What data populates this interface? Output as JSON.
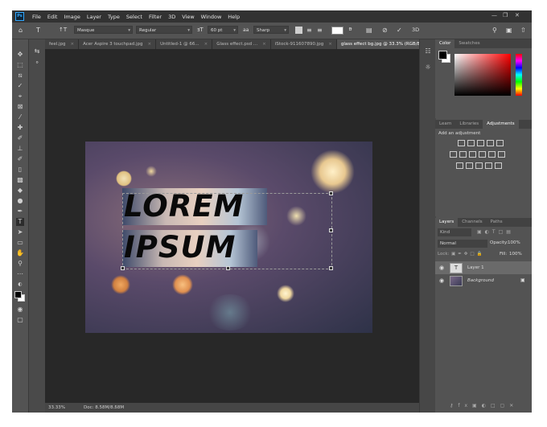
{
  "app": {
    "logo": "Ps"
  },
  "menu": [
    "File",
    "Edit",
    "Image",
    "Layer",
    "Type",
    "Select",
    "Filter",
    "3D",
    "View",
    "Window",
    "Help"
  ],
  "options": {
    "font_family": "Masque",
    "font_style": "Regular",
    "font_size": "60 pt",
    "antialias": "Sharp",
    "label_3d": "3D"
  },
  "tabs": [
    {
      "label": "feel.jpg",
      "active": false
    },
    {
      "label": "Acer Aspire 3 touchpad.jpg",
      "active": false
    },
    {
      "label": "Untitled-1 @ 66...",
      "active": false
    },
    {
      "label": "Glass effect.psd ...",
      "active": false
    },
    {
      "label": "iStock-911607890.jpg",
      "active": false
    },
    {
      "label": "glass effect bg.jpg @ 33.3% (RGB/8)",
      "active": true
    }
  ],
  "canvas": {
    "line1": "LOREM",
    "line2": "IPSUM"
  },
  "status": {
    "zoom": "33.33%",
    "doc": "Doc: 8.58M/8.58M"
  },
  "color_panel": {
    "tabs": [
      "Color",
      "Swatches"
    ]
  },
  "adjust_panel": {
    "tabs": [
      "Learn",
      "Libraries",
      "Adjustments"
    ],
    "add_label": "Add an adjustment"
  },
  "layers_panel": {
    "tabs": [
      "Layers",
      "Channels",
      "Paths"
    ],
    "kind": "Kind",
    "blend": "Normal",
    "opacity_label": "Opacity:",
    "opacity": "100%",
    "lock_label": "Lock:",
    "fill_label": "Fill:",
    "fill": "100%",
    "layers": [
      {
        "name": "Layer 1",
        "type": "text"
      },
      {
        "name": "Background",
        "type": "image"
      }
    ]
  },
  "colors": {
    "accent": "#31a8ff",
    "foreground": "#000000",
    "background": "#ffffff"
  }
}
